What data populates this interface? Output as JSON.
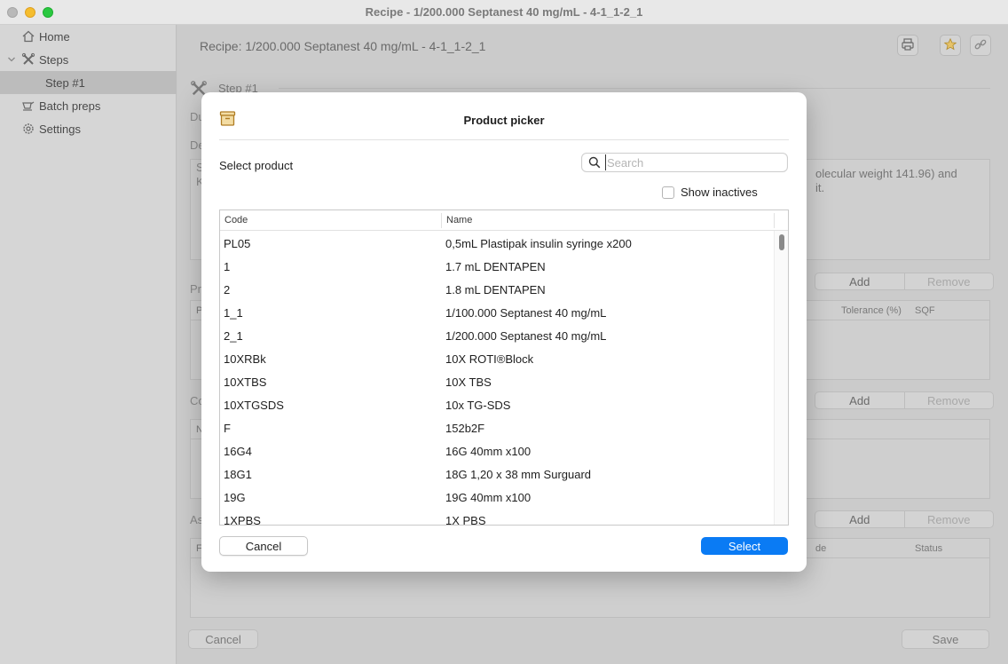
{
  "window": {
    "title": "Recipe - 1/200.000 Septanest 40 mg/mL - 4-1_1-2_1"
  },
  "sidebar": {
    "items": [
      {
        "label": "Home",
        "icon": "home-icon"
      },
      {
        "label": "Steps",
        "icon": "steps-icon"
      },
      {
        "label": "Step #1",
        "icon": ""
      },
      {
        "label": "Batch preps",
        "icon": "batch-icon"
      },
      {
        "label": "Settings",
        "icon": "gear-icon"
      }
    ]
  },
  "main": {
    "recipe_title": "Recipe: 1/200.000 Septanest 40 mg/mL - 4-1_1-2_1",
    "step_label": "Step #1",
    "frag_du": "Du",
    "frag_de": "De",
    "desc_left_1": "S",
    "desc_left_2": "K",
    "desc_right_1": "olecular weight 141.96) and",
    "desc_right_2": "it.",
    "frag_pr": "Pr",
    "frag_co": "Co",
    "frag_as": "As",
    "frag_p": "P",
    "frag_n": "N",
    "frag_fa": "Fa",
    "add_label": "Add",
    "remove_label": "Remove",
    "col_tolerance": "Tolerance (%)",
    "col_sqf": "SQF",
    "col_de": "de",
    "col_status": "Status",
    "cancel_label": "Cancel",
    "save_label": "Save"
  },
  "modal": {
    "title": "Product picker",
    "select_label": "Select product",
    "search_placeholder": "Search",
    "show_inactives": "Show inactives",
    "columns": {
      "code": "Code",
      "name": "Name"
    },
    "rows": [
      {
        "code": "PL05",
        "name": "0,5mL Plastipak insulin syringe x200"
      },
      {
        "code": "1",
        "name": "1.7 mL DENTAPEN"
      },
      {
        "code": "2",
        "name": "1.8 mL DENTAPEN"
      },
      {
        "code": "1_1",
        "name": "1/100.000 Septanest 40 mg/mL"
      },
      {
        "code": "2_1",
        "name": "1/200.000 Septanest 40 mg/mL"
      },
      {
        "code": "10XRBk",
        "name": "10X ROTI®Block"
      },
      {
        "code": "10XTBS",
        "name": "10X TBS"
      },
      {
        "code": "10XTGSDS",
        "name": "10x TG-SDS"
      },
      {
        "code": "F",
        "name": "152b2F"
      },
      {
        "code": "16G4",
        "name": "16G 40mm x100"
      },
      {
        "code": "18G1",
        "name": "18G 1,20 x 38 mm Surguard"
      },
      {
        "code": "19G",
        "name": "19G 40mm x100"
      },
      {
        "code": "1XPBS",
        "name": "1X PBS"
      }
    ],
    "cancel_label": "Cancel",
    "select_button": "Select",
    "accent_color": "#0a7bf4"
  }
}
